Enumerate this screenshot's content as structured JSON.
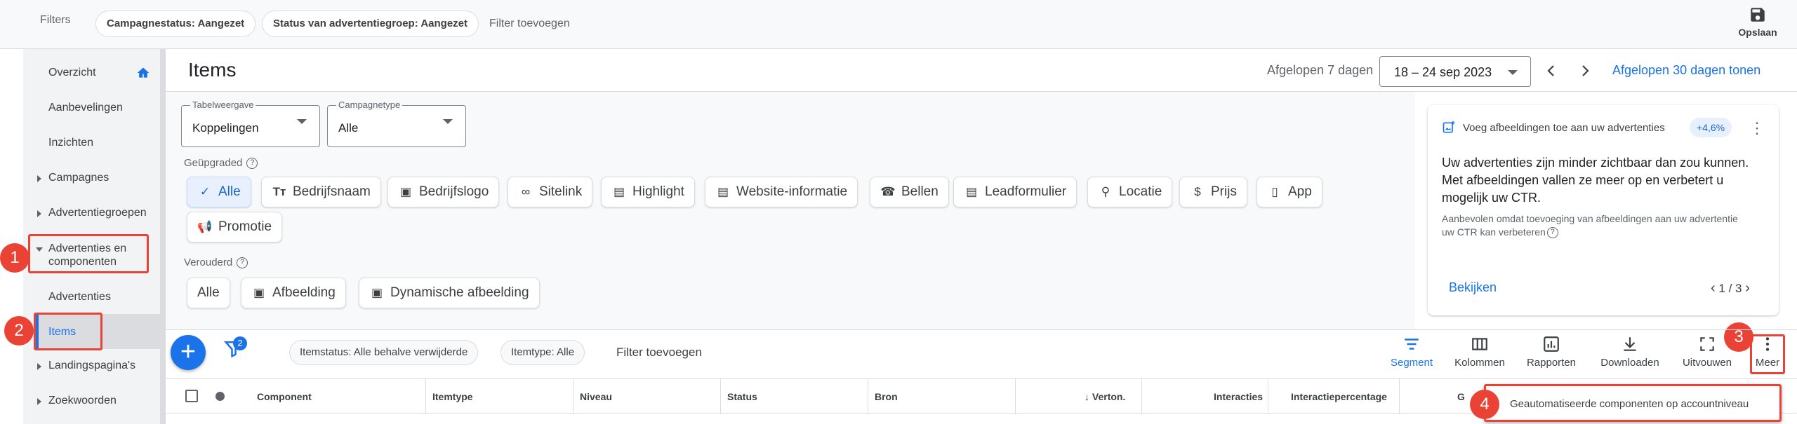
{
  "filters": {
    "label": "Filters",
    "chips": [
      "Campagnestatus: Aangezet",
      "Status van advertentiegroep: Aangezet"
    ],
    "add": "Filter toevoegen",
    "save_label": "Opslaan"
  },
  "sidebar": {
    "items": [
      {
        "label": "Overzicht"
      },
      {
        "label": "Aanbevelingen"
      },
      {
        "label": "Inzichten"
      },
      {
        "label": "Campagnes"
      },
      {
        "label": "Advertentiegroepen"
      },
      {
        "label": "Advertenties en componenten"
      },
      {
        "label": "Advertenties"
      },
      {
        "label": "Items"
      },
      {
        "label": "Landingspagina's"
      },
      {
        "label": "Zoekwoorden"
      }
    ]
  },
  "header": {
    "title": "Items",
    "date_label": "Afgelopen 7 dagen",
    "date_range": "18 – 24 sep 2023",
    "show_30": "Afgelopen 30 dagen tonen"
  },
  "selects": {
    "table_view": {
      "label": "Tabelweergave",
      "value": "Koppelingen"
    },
    "campaign_type": {
      "label": "Campagnetype",
      "value": "Alle"
    }
  },
  "upgraded": {
    "label": "Geüpgraded",
    "chips": [
      "Alle",
      "Bedrijfsnaam",
      "Bedrijfslogo",
      "Sitelink",
      "Highlight",
      "Website-informatie",
      "Bellen",
      "Leadformulier",
      "Locatie",
      "Prijs",
      "App",
      "Promotie"
    ]
  },
  "legacy": {
    "label": "Verouderd",
    "chips": [
      "Alle",
      "Afbeelding",
      "Dynamische afbeelding"
    ]
  },
  "card": {
    "header": "Voeg afbeeldingen toe aan uw advertenties",
    "pill": "+4,6%",
    "message": "Uw advertenties zijn minder zichtbaar dan zou kunnen. Met afbeeldingen vallen ze meer op en verbetert u mogelijk uw CTR.",
    "sub": "Aanbevolen omdat toevoeging van afbeeldingen aan uw advertentie uw CTR kan verbeteren",
    "view": "Bekijken",
    "pager": "1 / 3"
  },
  "toolbar": {
    "filter_count": "2",
    "chips": [
      "Itemstatus: Alle behalve verwijderde",
      "Itemtype: Alle"
    ],
    "add": "Filter toevoegen",
    "tools": [
      "Segment",
      "Kolommen",
      "Rapporten",
      "Downloaden",
      "Uitvouwen",
      "Meer"
    ]
  },
  "table": {
    "columns": [
      "Component",
      "Itemtype",
      "Niveau",
      "Status",
      "Bron",
      "Verton.",
      "Interacties",
      "Interactiepercentage",
      "G"
    ]
  },
  "menu": {
    "item": "Geautomatiseerde componenten op accountniveau"
  },
  "annotations": [
    "1",
    "2",
    "3",
    "4"
  ],
  "colors": {
    "accent": "#1a73e8",
    "annotation": "#ea4335"
  }
}
